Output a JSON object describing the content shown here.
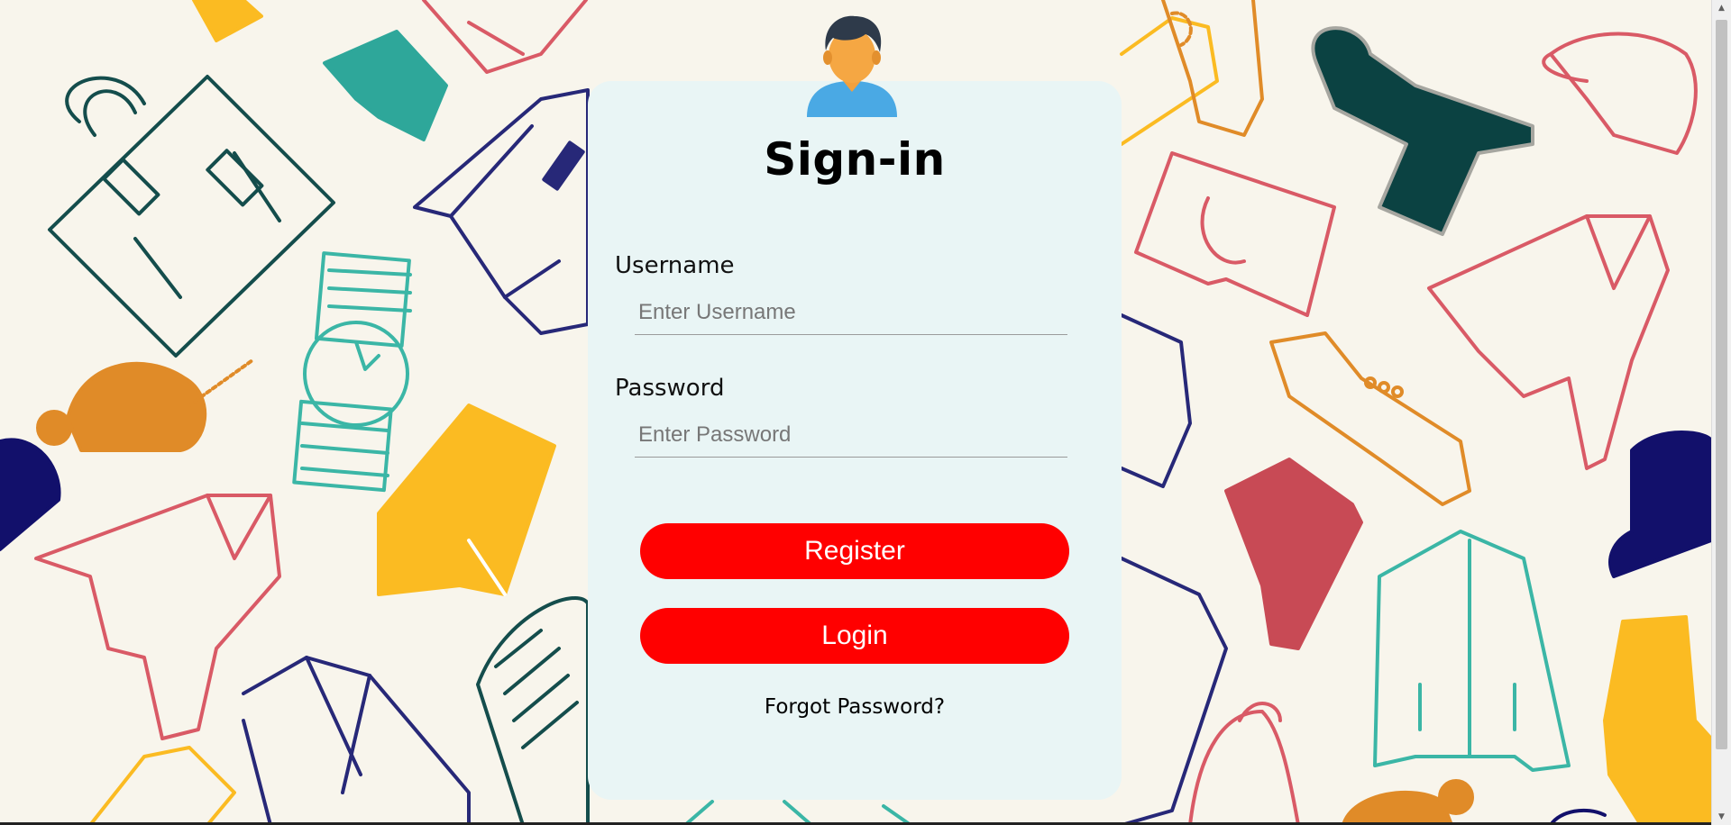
{
  "signin": {
    "title": "Sign-in",
    "username_label": "Username",
    "username_placeholder": "Enter Username",
    "password_label": "Password",
    "password_placeholder": "Enter Password",
    "register_label": "Register",
    "login_label": "Login",
    "forgot_label": "Forgot Password?"
  },
  "colors": {
    "button": "#ff0000",
    "card": "#e9f5f5",
    "background": "#f8f5ec"
  },
  "icons": {
    "avatar": "user-avatar-icon"
  }
}
